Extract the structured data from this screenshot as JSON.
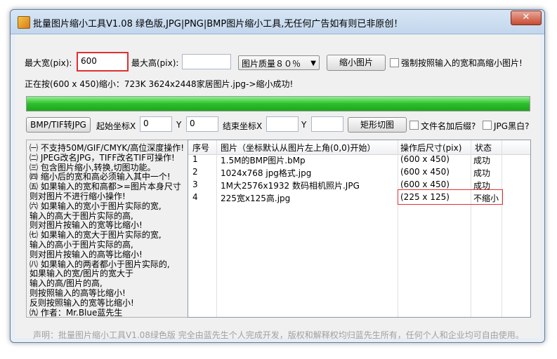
{
  "window": {
    "title": "批量图片缩小工具V1.08 绿色版,JPG|PNG|BMP图片缩小工具,无任何广告如有则已非原创！",
    "close_glyph": "✕"
  },
  "size_row": {
    "max_width_label": "最大宽(pix):",
    "max_width_value": "600",
    "max_height_label": "最大高(pix):",
    "max_height_value": "",
    "quality_select": "图片质量８０％",
    "shrink_button": "缩小图片",
    "force_label": "强制按照输入的宽和高缩小图片!"
  },
  "status": {
    "text": "正在按(600 x 450)缩小：723K 3624x2448家居图片.jpg->缩小成功!",
    "progress": 1.0
  },
  "crop_row": {
    "convert_button": "BMP/TIF转JPG",
    "start_label": "起始坐标X",
    "start_x": "0",
    "start_y_label": "Y",
    "start_y": "0",
    "end_label": "结束坐标X",
    "end_x": "",
    "end_y_label": "Y",
    "end_y": "",
    "crop_button": "矩形切图",
    "suffix_label": "文件名加后缀?",
    "jpg_black_label": "JPG黑白?"
  },
  "notes": [
    "㈠ 不支持50M/GIF/CMYK/高位深度操作!",
    "㈡ JPEG改名JPG，TIFF改名TIF可操作!",
    "㈢ 包含图片缩小,转换,切图功能。",
    "㈣ 缩小后的宽和高必须输入其中一个!",
    "㈤ 如果输入的宽和高都>=图片本身尺寸",
    "    则对图片不进行缩小操作!",
    "㈥ 如果输入的宽小于图片实际的宽,",
    "    输入的高大于图片实际的高,",
    "    则对图片按输入的宽等比缩小!",
    "㈦ 如果输入的宽大于图片实际的宽,",
    "    输入的高小于图片实际的高,",
    "    则对图片按输入的高等比缩小!",
    "㈧ 如果输入的两者都小于图片实际的,",
    "    如果输入的宽/图片的宽大于",
    "    输入的高/图片的高,",
    "    则按照输入的高等比缩小!",
    "    反则按照输入的宽等比缩小!",
    "㈨ 作者：Mr.Blue蓝先生"
  ],
  "table": {
    "headers": [
      "序号",
      "图片（坐标默认从图片左上角(0,0)开始）",
      "操作后尺寸(pix)",
      "状态"
    ],
    "rows": [
      [
        "1",
        "1.5M的BMP图片.bMp",
        "(600 x 450)",
        "成功"
      ],
      [
        "2",
        "1024x768 jpg格式.jpg",
        "(600 x 450)",
        "成功"
      ],
      [
        "3",
        "1M大2576x1932 数码相机照片.JPG",
        "(600 x 450)",
        "成功"
      ],
      [
        "4",
        "225宽x125高.jpg",
        "(225 x 125)",
        "不缩小"
      ]
    ]
  },
  "footer": "声明：批量图片缩小工具V1.08绿色版 完全由蓝先生个人完成开发，版权和解释权均归蓝先生所有，任何个人和企业均可自由使用。"
}
